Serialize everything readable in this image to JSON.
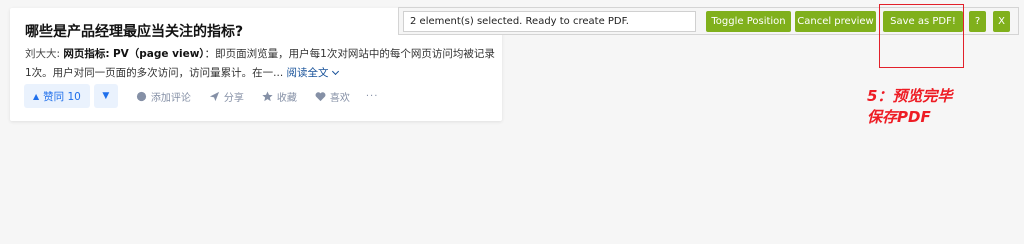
{
  "card": {
    "title": "哪些是产品经理最应当关注的指标?",
    "excerpt": {
      "author": "刘大大:",
      "term": "网页指标:",
      "term_en": "PV（page view）",
      "body": "：即页面浏览量，用户每1次对网站中的每个网页访问均被记录1次。用户对同一页面的多次访问，访问量累计。在一...",
      "read_more": "阅读全文"
    },
    "actions": {
      "upvote": "赞同 10",
      "comment": "添加评论",
      "share": "分享",
      "collect": "收藏",
      "like": "喜欢",
      "more": "···"
    }
  },
  "toolbar": {
    "status": "2 element(s) selected. Ready to create PDF.",
    "toggle_position": "Toggle Position",
    "cancel_preview": "Cancel preview",
    "save_pdf": "Save as PDF!",
    "help": "?",
    "close": "X",
    "button_color": "#80b01c"
  },
  "annotation": {
    "line1": "5：预览完毕",
    "line2": "保存PDF",
    "color": "#ee1c24"
  }
}
